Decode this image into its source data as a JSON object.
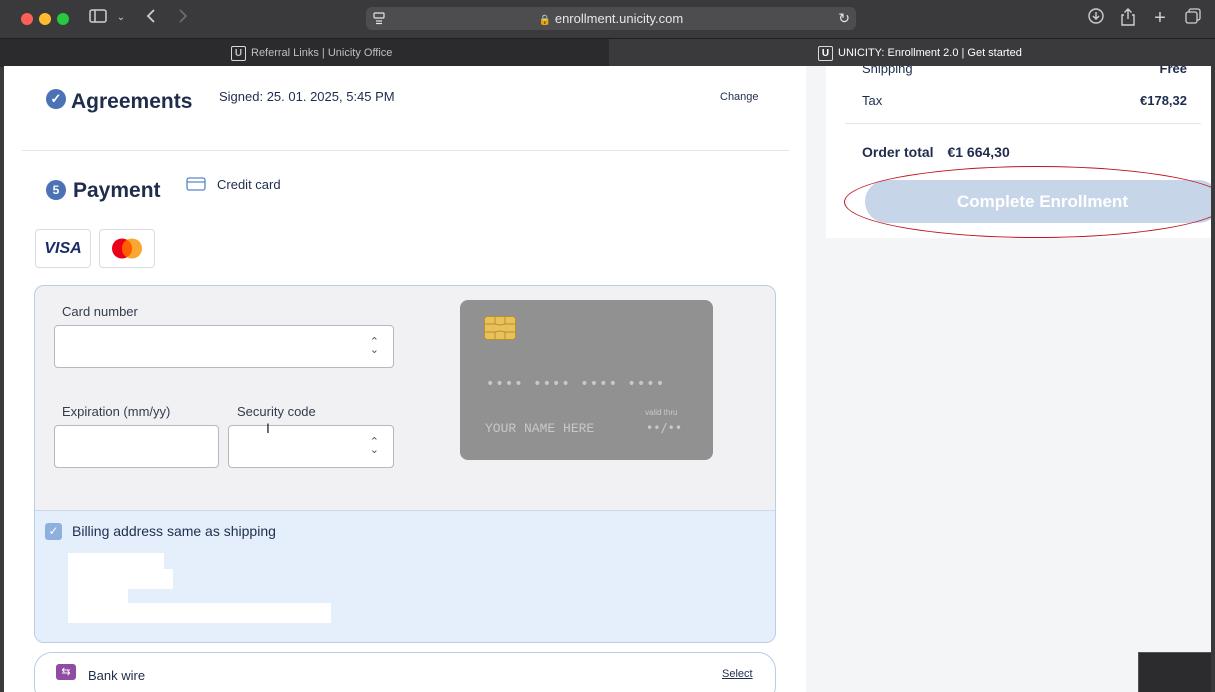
{
  "browser": {
    "url": "enrollment.unicity.com",
    "tabs": [
      {
        "title": "Referral Links | Unicity Office",
        "favicon": "U"
      },
      {
        "title": "UNICITY: Enrollment 2.0 | Get started",
        "favicon": "U"
      }
    ],
    "tab_close": "×"
  },
  "agreements": {
    "title": "Agreements",
    "signed": "Signed: 25. 01. 2025, 5:45 PM",
    "change": "Change"
  },
  "payment": {
    "step": "5",
    "title": "Payment",
    "method_label": "Credit card",
    "visa": "VISA",
    "card_number_label": "Card number",
    "expiration_label": "Expiration (mm/yy)",
    "security_label": "Security code",
    "card_preview": {
      "number": "•••• •••• •••• ••••",
      "name": "YOUR NAME HERE",
      "valid_thru": "valid thru",
      "expiry": "••/••"
    },
    "billing_label": "Billing address same as shipping",
    "bank_label": "Bank wire",
    "bank_select": "Select"
  },
  "summary": {
    "shipping_label": "Shipping",
    "shipping_value": "Free",
    "tax_label": "Tax",
    "tax_value": "€178,32",
    "total_label": "Order total",
    "total_value": "€1 664,30",
    "complete_button": "Complete Enrollment"
  },
  "colors": {
    "brand_navy": "#1f2d4d",
    "accent_blue": "#4b72b4",
    "button_disabled": "#c7d5e9",
    "annotation_red": "#c0141d",
    "bank_icon": "#8e4da3"
  }
}
